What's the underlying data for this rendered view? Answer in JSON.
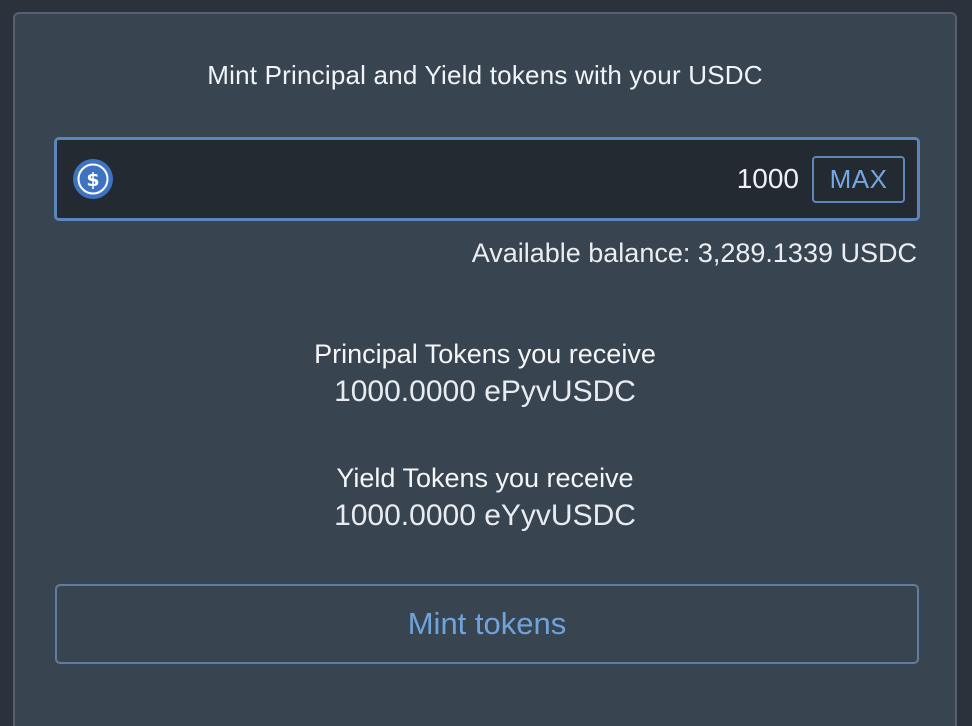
{
  "card": {
    "heading": "Mint Principal and Yield tokens with your USDC"
  },
  "amount_input": {
    "token_icon": "usdc-icon",
    "value": "1000",
    "max_label": "MAX"
  },
  "balance": {
    "text": "Available balance: 3,289.1339 USDC"
  },
  "principal": {
    "title": "Principal Tokens you receive",
    "amount": "1000.0000 ePyvUSDC"
  },
  "yield": {
    "title": "Yield Tokens you receive",
    "amount": "1000.0000 eYyvUSDC"
  },
  "mint_button": {
    "label": "Mint tokens"
  },
  "colors": {
    "page_bg": "#2b323b",
    "card_bg": "#394451",
    "input_bg": "#242a31",
    "accent": "#75a7e2",
    "usdc_blue": "#3e73c4"
  }
}
